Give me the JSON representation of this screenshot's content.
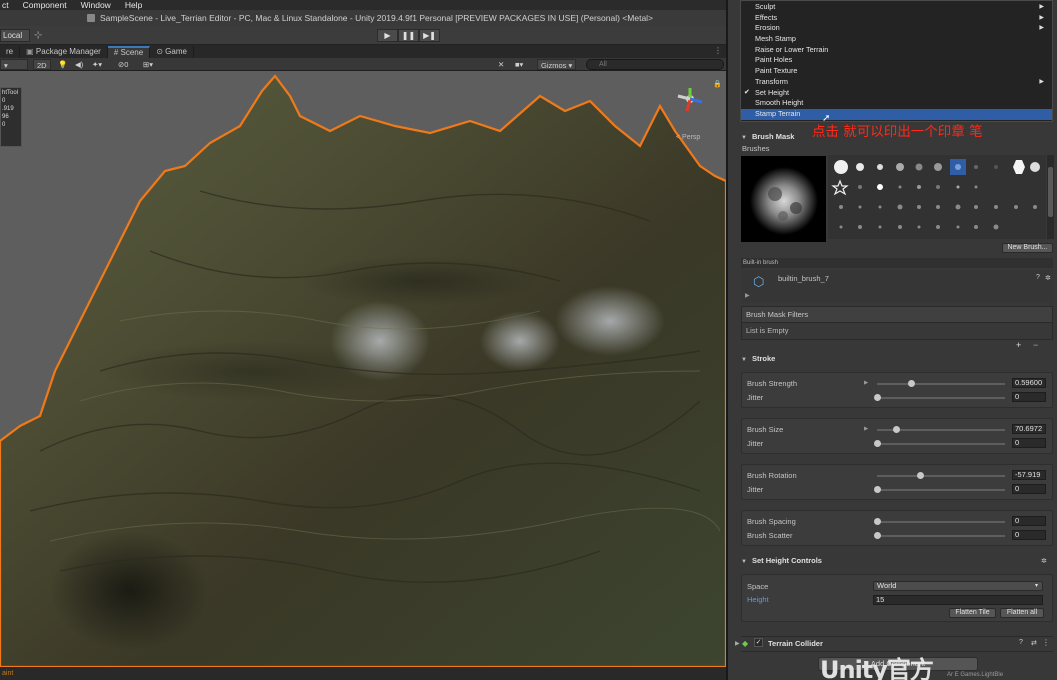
{
  "menubar": {
    "items": [
      "ct",
      "Component",
      "Window",
      "Help"
    ]
  },
  "window": {
    "title": "SampleScene - Live_Terrian Editor - PC, Mac & Linux Standalone - Unity 2019.4.9f1 Personal [PREVIEW PACKAGES IN USE] (Personal) <Metal>"
  },
  "toolbar": {
    "local_label": "Local",
    "play": "▶",
    "pause": "❚❚",
    "step": "▶❚"
  },
  "tabs": [
    {
      "label": "re"
    },
    {
      "label": "Package Manager"
    },
    {
      "label": "Scene",
      "active": true
    },
    {
      "label": "Game"
    }
  ],
  "scenebar": {
    "mode_2d": "2D",
    "count": "0",
    "gizmos": "Gizmos",
    "search_placeholder": "All"
  },
  "viewport": {
    "overlay_title": "htTool",
    "overlay_lines": [
      "0",
      "",
      ".919",
      "96",
      "0"
    ],
    "gizmo_label": "< Persp"
  },
  "statusbar": {
    "text": "aint"
  },
  "dropdown": {
    "items": [
      {
        "label": "Sculpt",
        "submenu": true
      },
      {
        "label": "Effects",
        "submenu": true
      },
      {
        "label": "Erosion",
        "submenu": true
      },
      {
        "label": "Mesh Stamp"
      },
      {
        "label": "Raise or Lower Terrain"
      },
      {
        "label": "Paint Holes"
      },
      {
        "label": "Paint Texture"
      },
      {
        "label": "Transform",
        "submenu": true
      },
      {
        "label": "Set Height",
        "checked": true
      },
      {
        "label": "Smooth Height"
      },
      {
        "label": "Stamp Terrain",
        "selected": true
      }
    ]
  },
  "annotation": {
    "text": "点击  就可以印出一个印章   笔"
  },
  "brush_mask": {
    "header": "Brush Mask",
    "brushes_label": "Brushes",
    "new_brush": "New Brush...",
    "builtin_tag": "Built-in brush",
    "brush_name": "builtin_brush_7",
    "filters_header": "Brush Mask Filters",
    "filters_empty": "List is Empty",
    "add": "+",
    "remove": "−"
  },
  "stroke": {
    "header": "Stroke",
    "strength_label": "Brush Strength",
    "strength_value": "0.59600",
    "strength_fraction": 0.27,
    "strength_jitter_label": "Jitter",
    "strength_jitter_value": "0",
    "size_label": "Brush Size",
    "size_value": "70.6972",
    "size_fraction": 0.15,
    "size_jitter_label": "Jitter",
    "size_jitter_value": "0",
    "rotation_label": "Brush Rotation",
    "rotation_value": "-57.919",
    "rotation_fraction": 0.34,
    "rotation_jitter_label": "Jitter",
    "rotation_jitter_value": "0",
    "spacing_label": "Brush Spacing",
    "spacing_value": "0",
    "scatter_label": "Brush Scatter",
    "scatter_value": "0"
  },
  "set_height": {
    "header": "Set Height Controls",
    "space_label": "Space",
    "space_value": "World",
    "height_label": "Height",
    "height_value": "15",
    "flatten_tile": "Flatten Tile",
    "flatten_all": "Flatten all"
  },
  "collider": {
    "label": "Terrain Collider"
  },
  "add_component": "Add Component",
  "watermark": {
    "text": "Unity官方",
    "sub": "Ar E Games.LightBle"
  },
  "colors": {
    "accent": "#3a79bb",
    "selection": "#2f5ea7",
    "annotation": "#ff2a1a",
    "terrain_outline": "#f07a1a"
  }
}
